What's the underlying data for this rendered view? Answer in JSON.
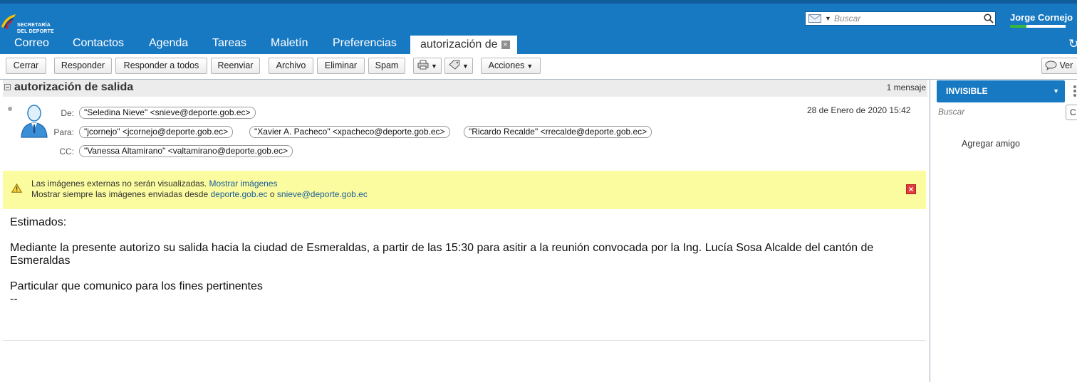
{
  "app": {
    "logo_line1": "SECRETARÍA",
    "logo_line2": "DEL DEPORTE",
    "search_placeholder": "Buscar",
    "user": "Jorge Cornejo",
    "quota_fraction": 0.3
  },
  "tabs": [
    {
      "label": "Correo"
    },
    {
      "label": "Contactos"
    },
    {
      "label": "Agenda"
    },
    {
      "label": "Tareas"
    },
    {
      "label": "Maletín"
    },
    {
      "label": "Preferencias"
    },
    {
      "label": "autorización de",
      "active": true
    }
  ],
  "toolbar": {
    "close": "Cerrar",
    "reply": "Responder",
    "reply_all": "Responder a todos",
    "forward": "Reenviar",
    "archive": "Archivo",
    "delete": "Eliminar",
    "spam": "Spam",
    "actions": "Acciones",
    "view": "Ver"
  },
  "message": {
    "subject": "autorización de salida",
    "count": "1 mensaje",
    "date": "28 de Enero de 2020 15:42",
    "from_label": "De:",
    "to_label": "Para:",
    "cc_label": "CC:",
    "from": "\"Seledina Nieve\" <snieve@deporte.gob.ec>",
    "to": [
      "\"jcornejo\" <jcornejo@deporte.gob.ec>",
      "\"Xavier A. Pacheco\" <xpacheco@deporte.gob.ec>",
      "\"Ricardo Recalde\" <rrecalde@deporte.gob.ec>"
    ],
    "cc": "\"Vanessa Altamirano\" <valtamirano@deporte.gob.ec>"
  },
  "banner": {
    "line1_text": "Las imágenes externas no serán visualizadas.",
    "line1_link": "Mostrar imágenes",
    "line2_text": "Mostrar siempre las imágenes enviadas desde",
    "line2_link1": "deporte.gob.ec",
    "line2_or": "o",
    "line2_link2": "snieve@deporte.gob.ec"
  },
  "body": {
    "greeting": "Estimados:",
    "para1_line1": "Mediante la presente autorizo su salida hacia la ciudad de Esmeraldas, a partir de las 15:30 para asitir a la reunión convocada por la Ing. Lucía Sosa Alcalde del cantón de",
    "para1_line2": "Esmeraldas",
    "para2": "Particular que comunico para los fines pertinentes",
    "signature_sep": "--"
  },
  "chat": {
    "status": "INVISIBLE",
    "search_placeholder": "Buscar",
    "add_friend": "Agregar amigo"
  },
  "colors": {
    "header_blue": "#1879c3",
    "banner_yellow": "#fbfb9f",
    "quota_green": "#38b73d"
  }
}
